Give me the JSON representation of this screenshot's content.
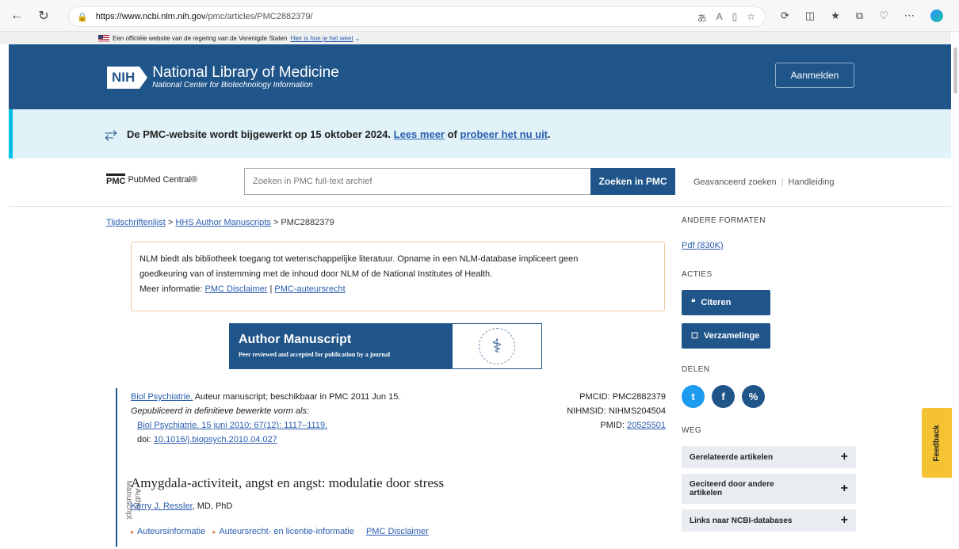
{
  "browser": {
    "url_host": "https://www.ncbi.nlm.nih.gov",
    "url_path": "/pmc/articles/PMC2882379/"
  },
  "gov_banner": {
    "text": "Een officiële website van de regering van de Verenigde Staten",
    "link": "Hier is hoe je het weet"
  },
  "header": {
    "logo": "NIH",
    "title": "National Library of Medicine",
    "subtitle": "National Center for Biotechnology Information",
    "login": "Aanmelden"
  },
  "alert": {
    "text": "De PMC-website wordt bijgewerkt op 15 oktober 2024.",
    "link1": "Lees meer",
    "mid": "of",
    "link2": "probeer het nu uit",
    "end": "."
  },
  "search": {
    "logo_mark": "PMC",
    "logo_text": "PubMed Central®",
    "placeholder": "Zoeken in PMC full-text archief",
    "button": "Zoeken in PMC",
    "advanced": "Geavanceerd zoeken",
    "guide": "Handleiding"
  },
  "breadcrumb": {
    "item1": "Tijdschriftenlijst",
    "sep": ">",
    "item2": "HHS Author Manuscripts",
    "current": "PMC2882379"
  },
  "disclaimer": {
    "line1": "NLM biedt als bibliotheek toegang tot wetenschappelijke literatuur. Opname in een NLM-database impliceert geen",
    "line2": "goedkeuring van of instemming met de inhoud door NLM of de National Institutes of Health.",
    "more_label": "Meer informatie:",
    "link1": "PMC Disclaimer",
    "sep": "|",
    "link2": "PMC-auteursrecht"
  },
  "manuscript_banner": {
    "title": "Author Manuscript",
    "subtitle": "Peer reviewed and accepted for publication by a journal"
  },
  "citation": {
    "journal_link": "Biol Psychiatrie.",
    "journal_rest": "Auteur manuscript; beschikbaar in PMC 2011 Jun 15.",
    "published_label": "Gepubliceerd in definitieve bewerkte vorm als:",
    "pub_link": "Biol Psychiatrie. 15 juni 2010; 67(12): 1117–1119.",
    "doi_label": "doi:",
    "doi": "10.1016/j.biopsych.2010.04.027",
    "side_label": "Author Manuscript"
  },
  "ids": {
    "pmcid": "PMCID: PMC2882379",
    "nihmsid": "NIHMSID: NIHMS204504",
    "pmid_label": "PMID:",
    "pmid": "20525501"
  },
  "article": {
    "title": "Amygdala-activiteit, angst en angst: modulatie door stress",
    "author": "Kerry J. Ressler",
    "author_suffix": ", MD, PhD",
    "links": [
      "Auteursinformatie",
      "Auteursrecht- en licentie-informatie",
      "PMC Disclaimer"
    ]
  },
  "sidebar": {
    "formats_heading": "ANDERE FORMATEN",
    "pdf": "Pdf (830K)",
    "actions_heading": "ACTIES",
    "cite_button": "Citeren",
    "collections_button": "Verzamelinge",
    "share_heading": "DELEN",
    "share": {
      "twitter": "t",
      "facebook": "f",
      "link": "%"
    },
    "way_heading": "WEG",
    "way_items": [
      "Gerelateerde artikelen",
      "Geciteerd door andere artikelen",
      "Links naar NCBI-databases"
    ],
    "plus": "+"
  },
  "feedback": "Feedback"
}
